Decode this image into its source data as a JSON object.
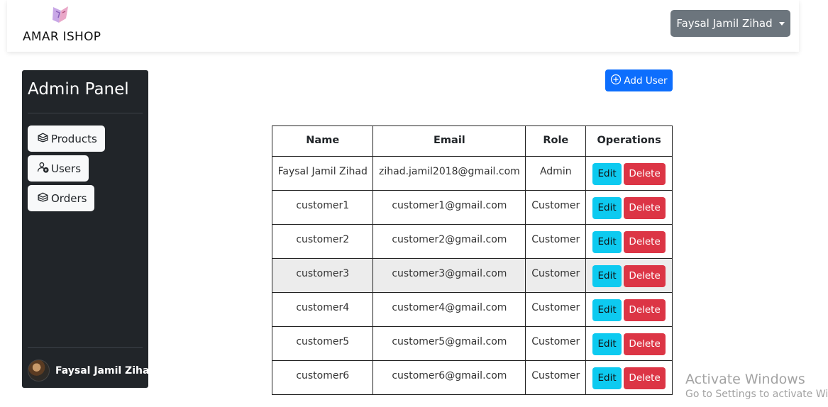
{
  "brand": {
    "name": "AMAR ISHOP",
    "logo_icon": "shop-logo-icon"
  },
  "header": {
    "user_menu_label": "Faysal Jamil Zihad"
  },
  "sidebar": {
    "title": "Admin Panel",
    "items": [
      {
        "label": "Products",
        "icon": "box-icon"
      },
      {
        "label": "Users",
        "icon": "user-add-icon"
      },
      {
        "label": "Orders",
        "icon": "box-icon"
      }
    ],
    "user": {
      "name": "Faysal Jamil Zihad"
    }
  },
  "toolbar": {
    "add_user_label": "Add User",
    "add_user_icon": "plus-circle-icon"
  },
  "table": {
    "columns": [
      "Name",
      "Email",
      "Role",
      "Operations"
    ],
    "edit_label": "Edit",
    "delete_label": "Delete",
    "rows": [
      {
        "name": "Faysal Jamil Zihad",
        "email": "zihad.jamil2018@gmail.com",
        "role": "Admin"
      },
      {
        "name": "customer1",
        "email": "customer1@gmail.com",
        "role": "Customer"
      },
      {
        "name": "customer2",
        "email": "customer2@gmail.com",
        "role": "Customer"
      },
      {
        "name": "customer3",
        "email": "customer3@gmail.com",
        "role": "Customer"
      },
      {
        "name": "customer4",
        "email": "customer4@gmail.com",
        "role": "Customer"
      },
      {
        "name": "customer5",
        "email": "customer5@gmail.com",
        "role": "Customer"
      },
      {
        "name": "customer6",
        "email": "customer6@gmail.com",
        "role": "Customer"
      }
    ]
  },
  "watermark": {
    "title": "Activate Windows",
    "subtitle": "Go to Settings to activate Windows."
  },
  "colors": {
    "primary": "#0d6efd",
    "info": "#0dcaf0",
    "danger": "#dc3545",
    "secondary": "#6c757d",
    "dark": "#212529"
  }
}
